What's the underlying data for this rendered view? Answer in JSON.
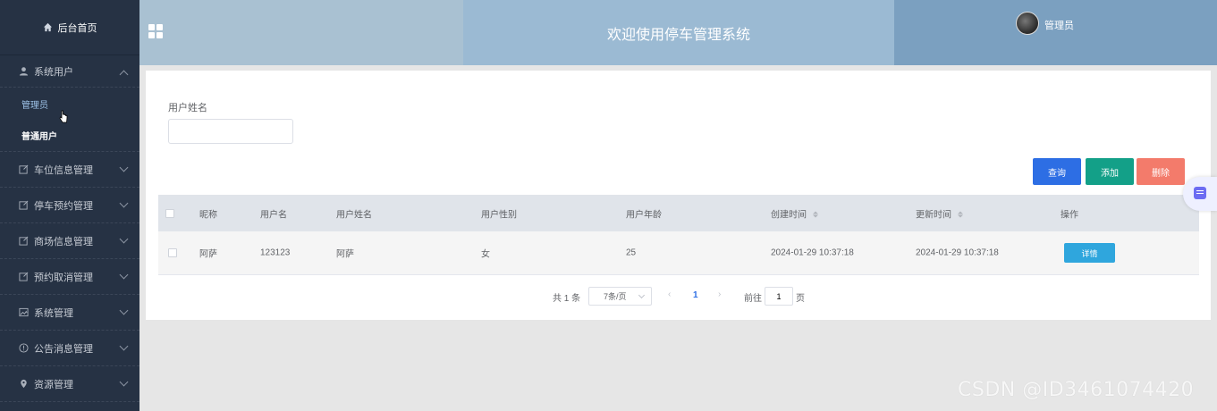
{
  "sidebar": {
    "home_label": "后台首页",
    "groups": [
      {
        "label": "系统用户",
        "icon": "user-icon",
        "expanded": true
      },
      {
        "label": "车位信息管理",
        "icon": "edit-icon"
      },
      {
        "label": "停车预约管理",
        "icon": "edit-icon"
      },
      {
        "label": "商场信息管理",
        "icon": "edit-icon"
      },
      {
        "label": "预约取消管理",
        "icon": "edit-icon"
      },
      {
        "label": "系统管理",
        "icon": "image-icon"
      },
      {
        "label": "公告消息管理",
        "icon": "info-icon"
      },
      {
        "label": "资源管理",
        "icon": "location-icon"
      }
    ],
    "sub_items": [
      "管理员",
      "普通用户"
    ]
  },
  "header": {
    "title": "欢迎使用停车管理系统",
    "user_name": "管理员"
  },
  "search": {
    "label": "用户姓名",
    "value": "",
    "placeholder": ""
  },
  "actions": {
    "query": "查询",
    "add": "添加",
    "delete": "删除"
  },
  "table": {
    "columns": [
      "昵称",
      "用户名",
      "用户姓名",
      "用户性别",
      "用户年龄",
      "创建时间",
      "更新时间",
      "操作"
    ],
    "rows": [
      {
        "nickname": "阿萨",
        "username": "123123",
        "realname": "阿萨",
        "gender": "女",
        "age": "25",
        "created": "2024-01-29 10:37:18",
        "updated": "2024-01-29 10:37:18",
        "action": "详情"
      }
    ]
  },
  "pagination": {
    "total_text": "共 1 条",
    "page_size": "7条/页",
    "current_page": "1",
    "goto_label": "前往",
    "goto_value": "1",
    "page_suffix": "页"
  },
  "watermark": "CSDN @ID3461074420",
  "colors": {
    "sidebar_bg": "#263244",
    "query_btn": "#2d6ee4",
    "add_btn": "#13a088",
    "delete_btn": "#f37b6b",
    "detail_btn": "#2fa6dd"
  }
}
